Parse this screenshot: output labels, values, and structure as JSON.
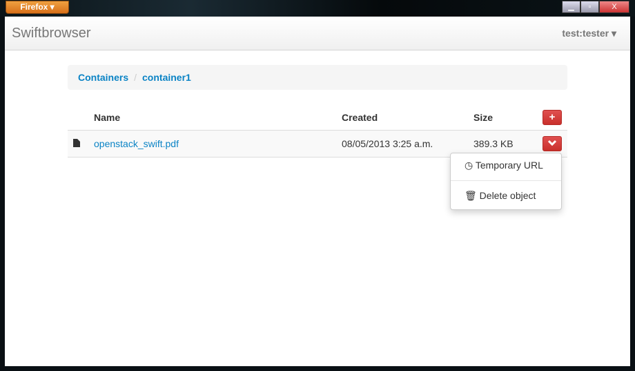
{
  "browser": {
    "menu_label": "Firefox ▾",
    "min": "▁",
    "max": "▫",
    "close": "X"
  },
  "navbar": {
    "brand": "Swiftbrowser",
    "user": "test:tester ▾"
  },
  "breadcrumb": [
    {
      "label": "Containers"
    },
    {
      "label": "container1"
    }
  ],
  "table": {
    "headers": [
      "Name",
      "Created",
      "Size"
    ],
    "add_icon": "+",
    "rows": [
      {
        "icon": "file-icon",
        "name": "openstack_swift.pdf",
        "created": "08/05/2013 3:25 a.m.",
        "size": "389.3 KB",
        "action_icon": "chevron-down-icon"
      }
    ]
  },
  "menu": {
    "items": [
      {
        "icon": "clock-icon",
        "label": "Temporary URL"
      },
      {
        "icon": "trash-icon",
        "label": "Delete object"
      }
    ]
  },
  "colors": {
    "link": "#0a83c5",
    "danger": "#d9534f"
  }
}
